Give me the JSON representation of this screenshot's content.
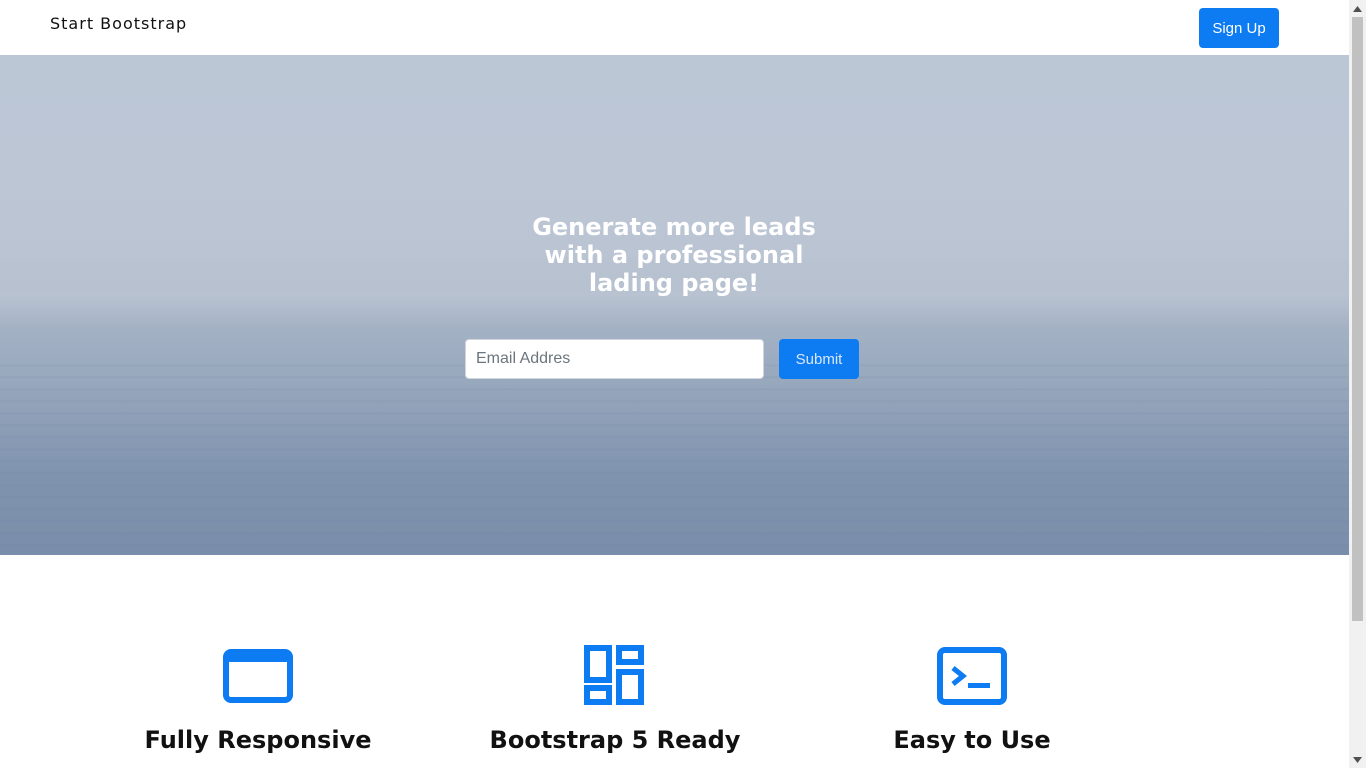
{
  "navbar": {
    "brand": "Start Bootstrap",
    "signup_label": "Sign Up"
  },
  "hero": {
    "title": "Generate more leads with a professional lading page!",
    "email_placeholder": "Email Addres",
    "submit_label": "Submit"
  },
  "features": [
    {
      "icon": "window-icon",
      "title": "Fully Responsive"
    },
    {
      "icon": "layout-grid-icon",
      "title": "Bootstrap 5 Ready"
    },
    {
      "icon": "terminal-icon",
      "title": "Easy to Use"
    }
  ],
  "colors": {
    "accent": "#0d7cf2",
    "hero_top": "#bcc7d6",
    "hero_bottom": "#7a8eab"
  }
}
